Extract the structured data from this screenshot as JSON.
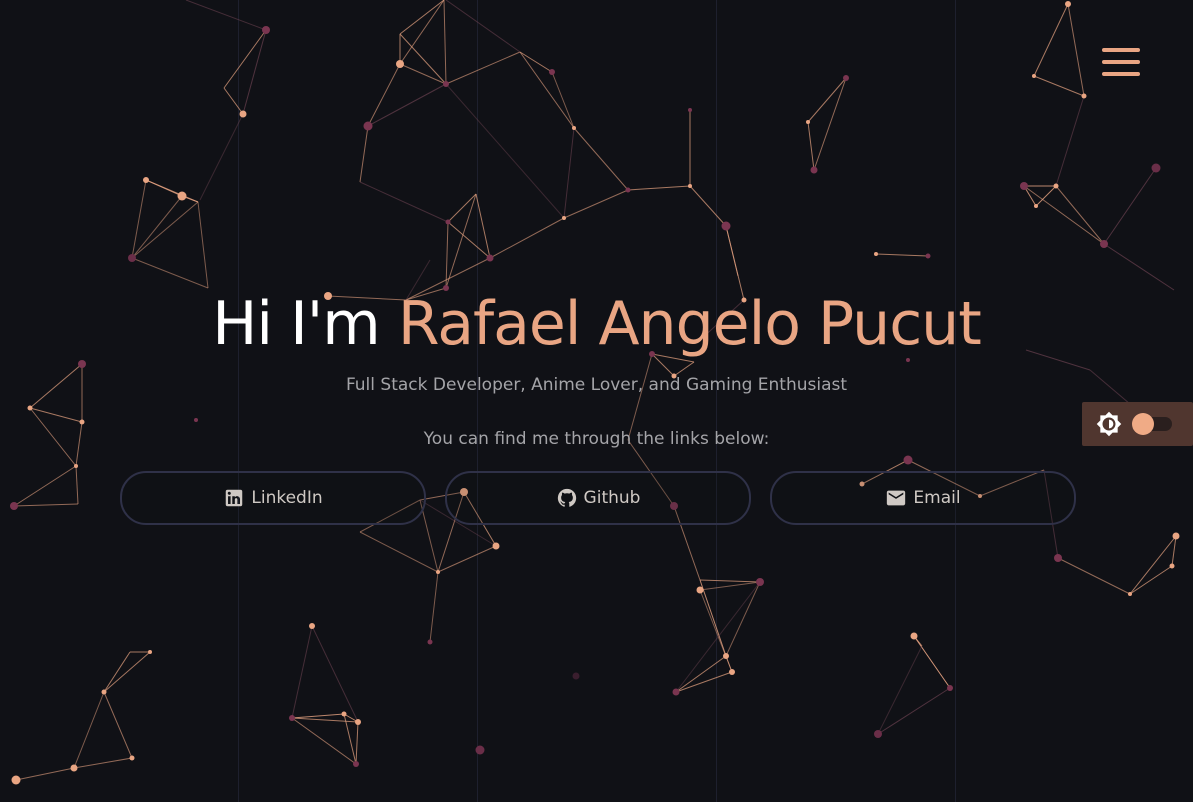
{
  "hero": {
    "greeting": "Hi I'm ",
    "name": "Rafael Angelo Pucut",
    "subtitle": "Full Stack Developer, Anime Lover, and Gaming Enthusiast",
    "links_intro": "You can find me through the links below:"
  },
  "links": [
    {
      "label": "LinkedIn",
      "icon": "linkedin-icon"
    },
    {
      "label": "Github",
      "icon": "github-icon"
    },
    {
      "label": "Email",
      "icon": "email-icon"
    }
  ],
  "header": {
    "menu_icon": "hamburger-menu-icon"
  },
  "theme_toggle": {
    "icon": "brightness-icon",
    "state": "dark"
  },
  "colors": {
    "background": "#101116",
    "accent": "#e9a583",
    "text": "#ffffff",
    "muted_text": "#a4a4a8",
    "button_border": "#2f3148",
    "toggle_panel": "#50362f"
  }
}
